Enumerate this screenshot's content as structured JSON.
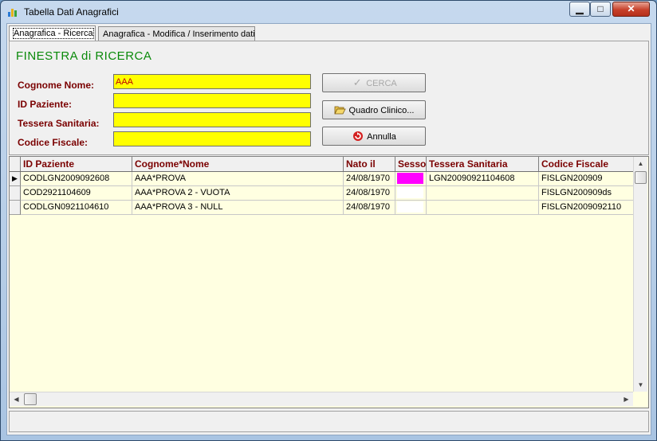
{
  "window": {
    "title": "Tabella Dati Anagrafici",
    "min_glyph": "▁",
    "max_glyph": "□",
    "close_glyph": "✕"
  },
  "tabs": [
    {
      "label": "Anagrafica - Ricerca",
      "active": true
    },
    {
      "label": "Anagrafica - Modifica / Inserimento dati",
      "active": false
    }
  ],
  "search": {
    "heading": "FINESTRA di RICERCA",
    "fields": [
      {
        "label": "Cognome Nome:",
        "value": "AAA"
      },
      {
        "label": "ID Paziente:",
        "value": ""
      },
      {
        "label": "Tessera Sanitaria:",
        "value": ""
      },
      {
        "label": "Codice Fiscale:",
        "value": ""
      }
    ],
    "buttons": {
      "cerca": "CERCA",
      "quadro": "Quadro Clinico...",
      "annulla": "Annulla"
    }
  },
  "grid": {
    "columns": [
      "ID Paziente",
      "Cognome*Nome",
      "Nato il",
      "Sesso",
      "Tessera Sanitaria",
      "Codice Fiscale"
    ],
    "rows": [
      {
        "id": "CODLGN2009092608",
        "nome": "AAA*PROVA",
        "nato": "24/08/1970",
        "sesso_color": "#ff00ff",
        "tessera": "LGN20090921104608",
        "cf": "FISLGN200909",
        "current": true
      },
      {
        "id": "COD2921104609",
        "nome": "AAA*PROVA 2 - VUOTA",
        "nato": "24/08/1970",
        "sesso_color": "#ffffff",
        "tessera": "",
        "cf": "FISLGN200909ds",
        "current": false
      },
      {
        "id": "CODLGN0921104610",
        "nome": "AAA*PROVA 3 - NULL",
        "nato": "24/08/1970",
        "sesso_color": "#ffffff",
        "tessera": "",
        "cf": "FISLGN2009092110",
        "current": false
      }
    ]
  },
  "colors": {
    "heading": "#0a8a0a",
    "label": "#7a0000",
    "field_bg": "#ffff00",
    "grid_bg": "#ffffe1"
  }
}
